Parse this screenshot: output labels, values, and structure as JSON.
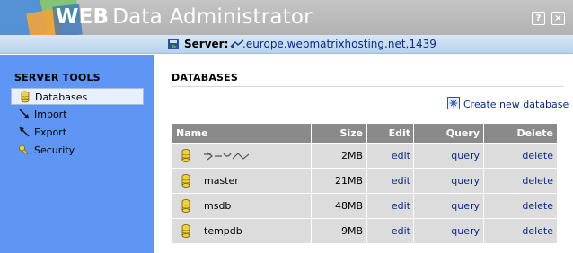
{
  "header": {
    "title_bold": "WEB",
    "title_rest": "Data Administrator",
    "help_label": "?",
    "close_label": "×"
  },
  "server": {
    "label": "Server:",
    "name": ".europe.webmatrixhosting.net,1439"
  },
  "sidebar": {
    "title": "SERVER TOOLS",
    "items": [
      {
        "label": "Databases",
        "icon": "database-icon",
        "active": true
      },
      {
        "label": "Import",
        "icon": "import-icon",
        "active": false
      },
      {
        "label": "Export",
        "icon": "export-icon",
        "active": false
      },
      {
        "label": "Security",
        "icon": "key-icon",
        "active": false
      }
    ]
  },
  "main": {
    "title": "DATABASES",
    "create_label": "Create new database",
    "columns": [
      "Name",
      "Size",
      "Edit",
      "Query",
      "Delete"
    ],
    "rows": [
      {
        "name": "",
        "size": "2MB",
        "edit": "edit",
        "query": "query",
        "delete": "delete"
      },
      {
        "name": "master",
        "size": "21MB",
        "edit": "edit",
        "query": "query",
        "delete": "delete"
      },
      {
        "name": "msdb",
        "size": "48MB",
        "edit": "edit",
        "query": "query",
        "delete": "delete"
      },
      {
        "name": "tempdb",
        "size": "9MB",
        "edit": "edit",
        "query": "query",
        "delete": "delete"
      }
    ]
  },
  "colors": {
    "sidebar_bg": "#5f95f5",
    "header_bg": "#b8b8b8",
    "server_bar_bg": "#c9dcf2",
    "table_header_bg": "#8a8a8a",
    "table_row_bg": "#dcdcdc",
    "link": "#0a2b80"
  }
}
